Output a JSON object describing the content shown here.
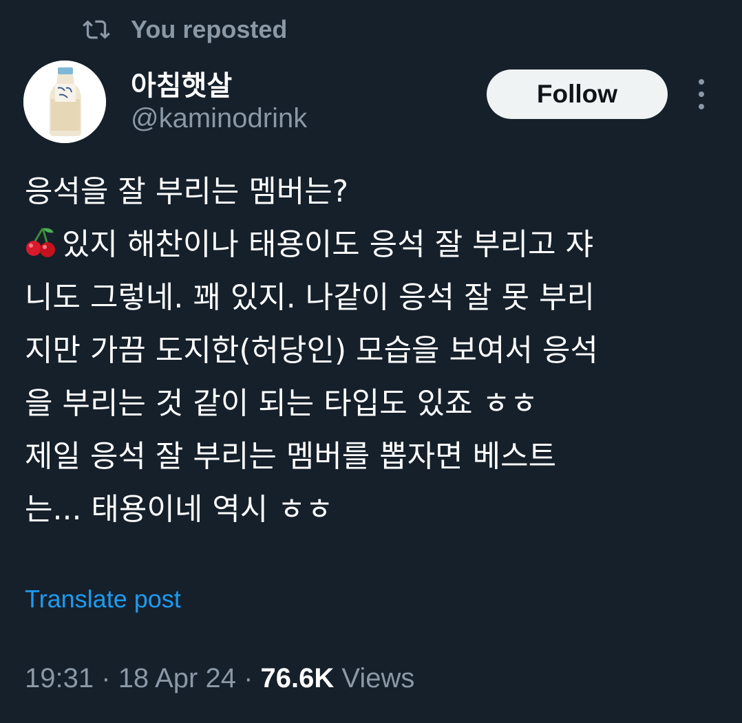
{
  "repost": {
    "label": "You reposted",
    "icon": "repost-icon"
  },
  "author": {
    "display_name": "아침햇살",
    "handle": "@kaminodrink",
    "avatar_icon": "bottle-avatar"
  },
  "actions": {
    "follow_label": "Follow",
    "more_icon": "more-icon"
  },
  "post": {
    "lines": [
      "응석을 잘 부리는 멤버는?",
      "있지 해찬이나 태용이도 응석 잘 부리고 쟈",
      "니도 그렇네. 꽤 있지. 나같이 응석 잘 못 부리",
      "지만 가끔 도지한(허당인) 모습을 보여서 응석",
      "을 부리는 것 같이 되는 타입도 있죠 ㅎㅎ",
      "제일 응석 잘 부리는 멤버를 뽑자면 베스트",
      "는... 태용이네 역시 ㅎㅎ"
    ],
    "emoji": "cherry-icon"
  },
  "translate_label": "Translate post",
  "meta": {
    "time": "19:31",
    "separator": "·",
    "date": "18 Apr 24",
    "views_count": "76.6K",
    "views_label": "Views"
  },
  "colors": {
    "background": "#15202b",
    "secondary_text": "#8b98a5",
    "link": "#1d9bf0",
    "follow_bg": "#eff3f4"
  }
}
